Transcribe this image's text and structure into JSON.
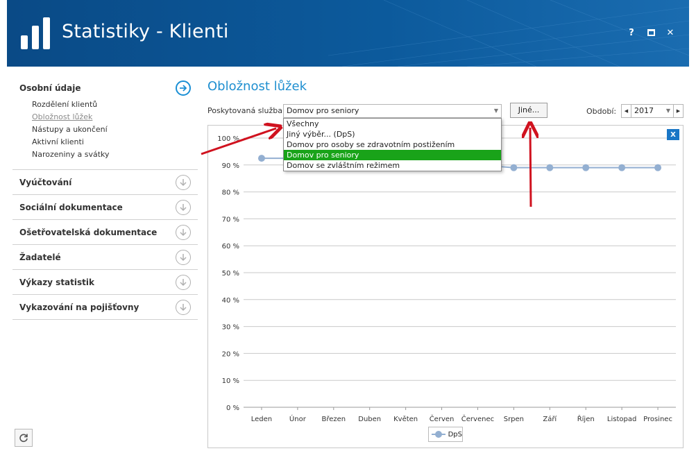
{
  "window": {
    "title": "Statistiky - Klienti",
    "help_label": "?",
    "close_label": "✕"
  },
  "sidebar": {
    "sections": [
      {
        "label": "Osobní údaje",
        "expanded": true,
        "items": [
          "Rozdělení klientů",
          "Obložnost lůžek",
          "Nástupy a ukončení",
          "Aktivní klienti",
          "Narozeniny a svátky"
        ],
        "current": "Obložnost lůžek"
      },
      {
        "label": "Vyúčtování"
      },
      {
        "label": "Sociální dokumentace"
      },
      {
        "label": "Ošetřovatelská dokumentace"
      },
      {
        "label": "Žadatelé"
      },
      {
        "label": "Výkazy statistik"
      },
      {
        "label": "Vykazování na pojišťovny"
      }
    ]
  },
  "main": {
    "title": "Obložnost lůžek",
    "service_label": "Poskytovaná služba:",
    "service_value": "Domov pro seniory",
    "other_button": "Jiné...",
    "period_label": "Období:",
    "year": "2017",
    "dropdown_options": [
      "Všechny",
      "Jiný výběr... (DpS)",
      "Domov pro osoby se zdravotním postižením",
      "Domov pro seniory",
      "Domov se zvláštním režimem"
    ],
    "dropdown_selected": "Domov pro seniory",
    "export_icon_label": "X"
  },
  "colors": {
    "accent": "#1f8fd0",
    "titlebar": "#0c5a9c",
    "selected": "#19a319",
    "series": "#93afd1",
    "arrow": "#d0121f"
  },
  "chart_data": {
    "type": "line",
    "categories": [
      "Leden",
      "Únor",
      "Březen",
      "Duben",
      "Květen",
      "Červen",
      "Červenec",
      "Srpen",
      "Září",
      "Říjen",
      "Listopad",
      "Prosinec"
    ],
    "series": [
      {
        "name": "DpS",
        "values": [
          92.5,
          92.5,
          92,
          92,
          92,
          91,
          90,
          89,
          89,
          89,
          89,
          89
        ]
      }
    ],
    "ylim": [
      0,
      100
    ],
    "yticks": [
      0,
      10,
      20,
      30,
      40,
      50,
      60,
      70,
      80,
      90,
      100
    ],
    "ytick_labels": [
      "0 %",
      "10 %",
      "20 %",
      "30 %",
      "40 %",
      "50 %",
      "60 %",
      "70 %",
      "80 %",
      "90 %",
      "100 %"
    ],
    "grid": true,
    "legend": "bottom-center"
  }
}
